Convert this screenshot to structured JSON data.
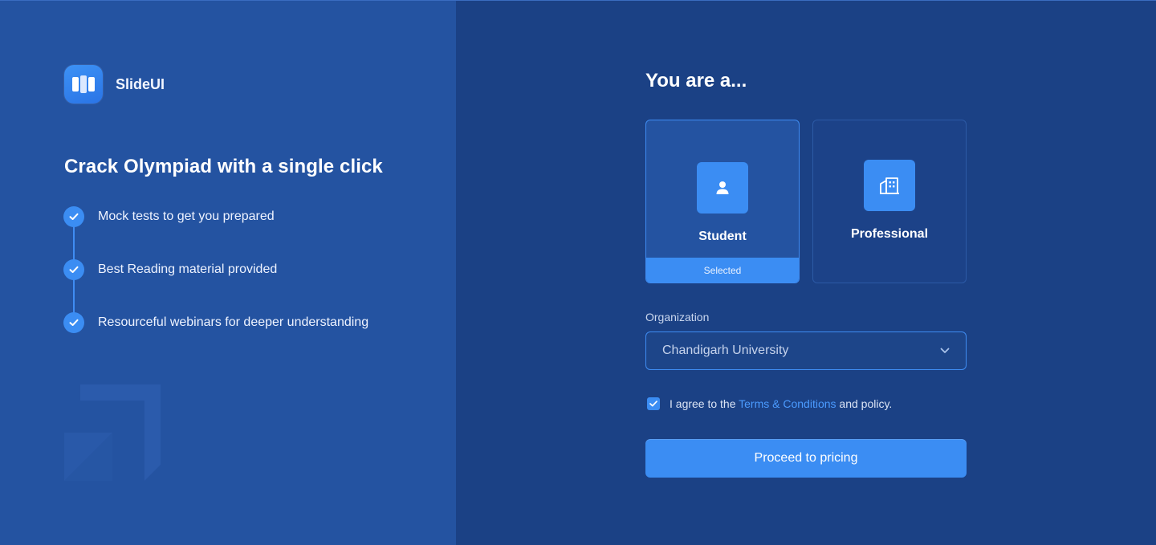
{
  "brand": {
    "name": "SlideUI",
    "logo_icon": "book-icon"
  },
  "hero": {
    "headline": "Crack Olympiad with a single click",
    "features": [
      {
        "text": "Mock tests to get you prepared",
        "icon": "check-icon"
      },
      {
        "text": "Best Reading material provided",
        "icon": "check-icon"
      },
      {
        "text": "Resourceful webinars for deeper understanding",
        "icon": "check-icon"
      }
    ]
  },
  "form": {
    "title": "You are a...",
    "roles": [
      {
        "label": "Student",
        "icon": "user-icon",
        "selected": true,
        "selected_label": "Selected"
      },
      {
        "label": "Professional",
        "icon": "building-icon",
        "selected": false
      }
    ],
    "organization": {
      "label": "Organization",
      "value": "Chandigarh University",
      "icon": "chevron-down-icon"
    },
    "agreement": {
      "checked": true,
      "prefix": "I agree to the ",
      "link": "Terms & Conditions",
      "suffix": " and policy."
    },
    "submit_label": "Proceed to pricing"
  },
  "colors": {
    "left_panel": "#2453a1",
    "right_panel": "#1b4185",
    "accent": "#3b8df3",
    "link": "#4b9bff"
  }
}
